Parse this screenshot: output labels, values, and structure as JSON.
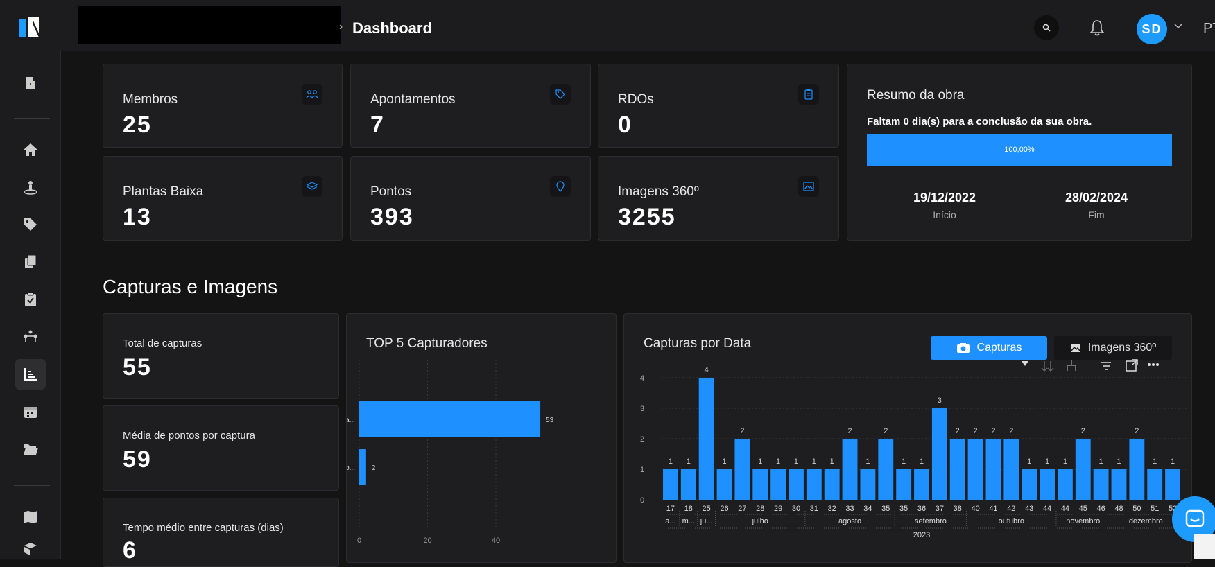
{
  "header": {
    "breadcrumb_separator": "›",
    "title": "Dashboard",
    "avatar_initials": "SD",
    "language": "PT"
  },
  "sidebar": {
    "items": [
      {
        "icon": "door-exit-icon"
      },
      {
        "icon": "home-icon"
      },
      {
        "icon": "map-pin-person-icon"
      },
      {
        "icon": "tag-icon"
      },
      {
        "icon": "documents-icon"
      },
      {
        "icon": "clipboard-check-icon"
      },
      {
        "icon": "network-icon"
      },
      {
        "icon": "chart-icon",
        "active": true
      },
      {
        "icon": "calendar-icon"
      },
      {
        "icon": "folder-open-icon"
      },
      {
        "icon": "map-icon"
      },
      {
        "icon": "box-icon"
      }
    ]
  },
  "stats": {
    "membros": {
      "label": "Membros",
      "value": "25",
      "icon": "users-icon"
    },
    "apontamentos": {
      "label": "Apontamentos",
      "value": "7",
      "icon": "tag-icon"
    },
    "rdos": {
      "label": "RDOs",
      "value": "0",
      "icon": "clipboard-icon"
    },
    "plantas": {
      "label": "Plantas Baixa",
      "value": "13",
      "icon": "layers-icon"
    },
    "pontos": {
      "label": "Pontos",
      "value": "393",
      "icon": "location-pin-icon"
    },
    "imagens": {
      "label": "Imagens 360º",
      "value": "3255",
      "icon": "image-icon"
    }
  },
  "resumo": {
    "title": "Resumo da obra",
    "subtitle": "Faltam 0 dia(s) para a conclusão da sua obra.",
    "progress_label": "100,00%",
    "progress": 1.0,
    "start_date": "19/12/2022",
    "start_label": "Início",
    "end_date": "28/02/2024",
    "end_label": "Fim"
  },
  "capturas": {
    "section_title": "Capturas e Imagens",
    "total_label": "Total de capturas",
    "total_value": "55",
    "media_label": "Média de pontos por captura",
    "media_value": "59",
    "tempo_label": "Tempo médio entre capturas (dias)",
    "tempo_value": "6"
  },
  "top5": {
    "title": "TOP 5 Capturadores",
    "chart_data": {
      "type": "bar",
      "orientation": "horizontal",
      "categories": [
        "Cristia...",
        "Juliano..."
      ],
      "values": [
        53,
        2
      ],
      "xticks": [
        "0",
        "20",
        "40"
      ],
      "xlim": [
        0,
        54
      ]
    },
    "color": "#1e90ff"
  },
  "por_data": {
    "title": "Capturas por Data",
    "tab_capturas": "Capturas",
    "tab_imagens": "Imagens 360º",
    "chart_data": {
      "type": "bar",
      "categories": [
        "17",
        "18",
        "25",
        "26",
        "27",
        "28",
        "29",
        "30",
        "31",
        "32",
        "33",
        "34",
        "35",
        "35",
        "36",
        "37",
        "38",
        "40",
        "41",
        "42",
        "43",
        "44",
        "44",
        "45",
        "46",
        "48",
        "50",
        "51",
        "52"
      ],
      "values": [
        1,
        1,
        4,
        1,
        2,
        1,
        1,
        1,
        1,
        1,
        2,
        1,
        2,
        1,
        1,
        3,
        2,
        2,
        2,
        2,
        1,
        1,
        1,
        2,
        1,
        1,
        2,
        1,
        1
      ],
      "yticks": [
        "0",
        "1",
        "2",
        "3",
        "4"
      ],
      "ylim": [
        0,
        4
      ],
      "months": [
        {
          "label": "a...",
          "start": 0,
          "end": 0
        },
        {
          "label": "m...",
          "start": 1,
          "end": 1
        },
        {
          "label": "ju...",
          "start": 2,
          "end": 2
        },
        {
          "label": "julho",
          "start": 3,
          "end": 7
        },
        {
          "label": "agosto",
          "start": 8,
          "end": 12
        },
        {
          "label": "setembro",
          "start": 13,
          "end": 16
        },
        {
          "label": "outubro",
          "start": 17,
          "end": 21
        },
        {
          "label": "novembro",
          "start": 22,
          "end": 24
        },
        {
          "label": "dezembro",
          "start": 25,
          "end": 28
        }
      ],
      "year": "2023"
    },
    "color": "#1e90ff"
  }
}
